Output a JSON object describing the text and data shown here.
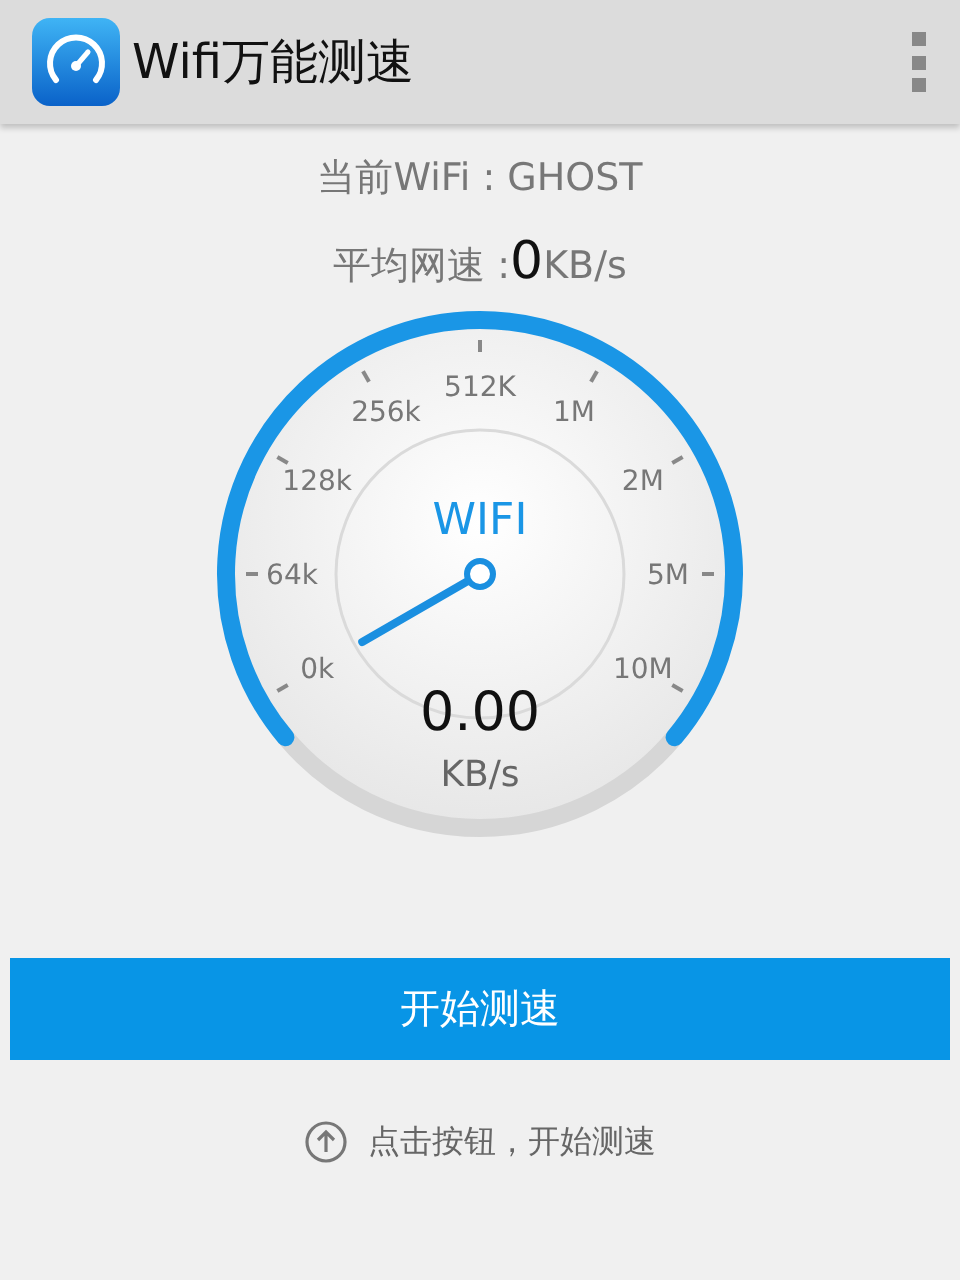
{
  "app_bar": {
    "title": "Wifi万能测速"
  },
  "current_wifi": "当前WiFi : GHOST",
  "average_speed": {
    "label": "平均网速 : ",
    "value": "0",
    "unit": "KB/s"
  },
  "gauge": {
    "title": "WIFI",
    "reading": "0.00",
    "unit": "KB/s",
    "scale": [
      "0k",
      "64k",
      "128k",
      "256k",
      "512K",
      "1M",
      "2M",
      "5M",
      "10M"
    ]
  },
  "start_button": "开始测速",
  "hint": "点击按钮，开始测速"
}
